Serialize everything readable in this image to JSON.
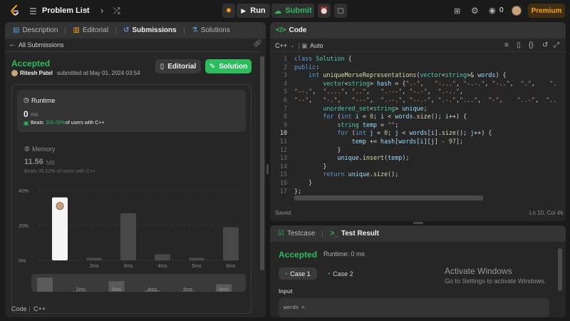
{
  "topbar": {
    "problem_list": "Problem List",
    "run": "Run",
    "submit": "Submit",
    "notifications": "0",
    "premium": "Premium"
  },
  "left": {
    "tabs": [
      "Description",
      "Editorial",
      "Submissions",
      "Solutions"
    ],
    "back_label": "All Submissions",
    "status": "Accepted",
    "author": "Ritesh Patel",
    "submitted_text": "submitted at May 01, 2024 03:54",
    "editorial_btn": "Editorial",
    "solution_btn": "Solution",
    "runtime": {
      "title": "Runtime",
      "value": "0",
      "unit": "ms",
      "beats_prefix": "Beats",
      "beats_pct": "100.00%",
      "beats_suffix": "of users with C++"
    },
    "memory": {
      "title": "Memory",
      "value": "11.56",
      "unit": "MB",
      "beats_text": "Beats 35.22% of users with C++"
    },
    "footer": {
      "code": "Code",
      "lang": "C++"
    }
  },
  "chart_data": {
    "type": "bar",
    "categories": [
      "0ms",
      "2ms",
      "3ms",
      "4ms",
      "5ms",
      "6ms"
    ],
    "values": [
      36,
      1.5,
      27,
      3.5,
      1.5,
      19
    ],
    "ylim": [
      0,
      40
    ],
    "yticks": [
      "40%",
      "20%",
      "0%"
    ],
    "xticklabels": [
      "",
      "2ms",
      "3ms",
      "4ms",
      "5ms",
      "6ms"
    ],
    "highlight": "0ms"
  },
  "editor": {
    "title": "Code",
    "lang": "C++",
    "mode": "Auto",
    "status": "Saved",
    "cursor": "Ln 10, Col 46",
    "lines": [
      "class Solution {",
      "public:",
      "    int uniqueMorseRepresentations(vector<string>& words) {",
      "        vector<string> hash = {\".-\",   \"-...\", \"-.-.\", \"-..\",  \".\",    \"..-.\",",
      "\"--.\",  \"....\", \"..\",   \".---\", \"-.-\",  \".-..\",",
      "\"--\",   \"-.\",   \"---\",  \".--.\", \"--.-\", \".-.\",\"...\",  \"-\",    \"..-\",  \"...-\", \".--\",",
      "        unordered_set<string> unique;",
      "        for (int i = 0; i < words.size(); i++) {",
      "            string temp = \"\";",
      "            for (int j = 0; j < words[i].size(); j++) {",
      "                temp += hash[words[i][j] - 97];",
      "            }",
      "            unique.insert(temp);",
      "        }",
      "        return unique.size();",
      "    }",
      "};"
    ]
  },
  "bottom": {
    "tab1": "Testcase",
    "tab2": "Test Result",
    "status": "Accepted",
    "runtime": "Runtime: 0 ms",
    "case1": "Case 1",
    "case2": "Case 2",
    "input_label": "Input",
    "words_label": "words ="
  },
  "watermark": {
    "line1": "Activate Windows",
    "line2": "Go to Settings to activate Windows."
  },
  "colors": {
    "accent": "#2cbb5d",
    "premium": "#ffa116",
    "link": "#5b9bd5"
  }
}
